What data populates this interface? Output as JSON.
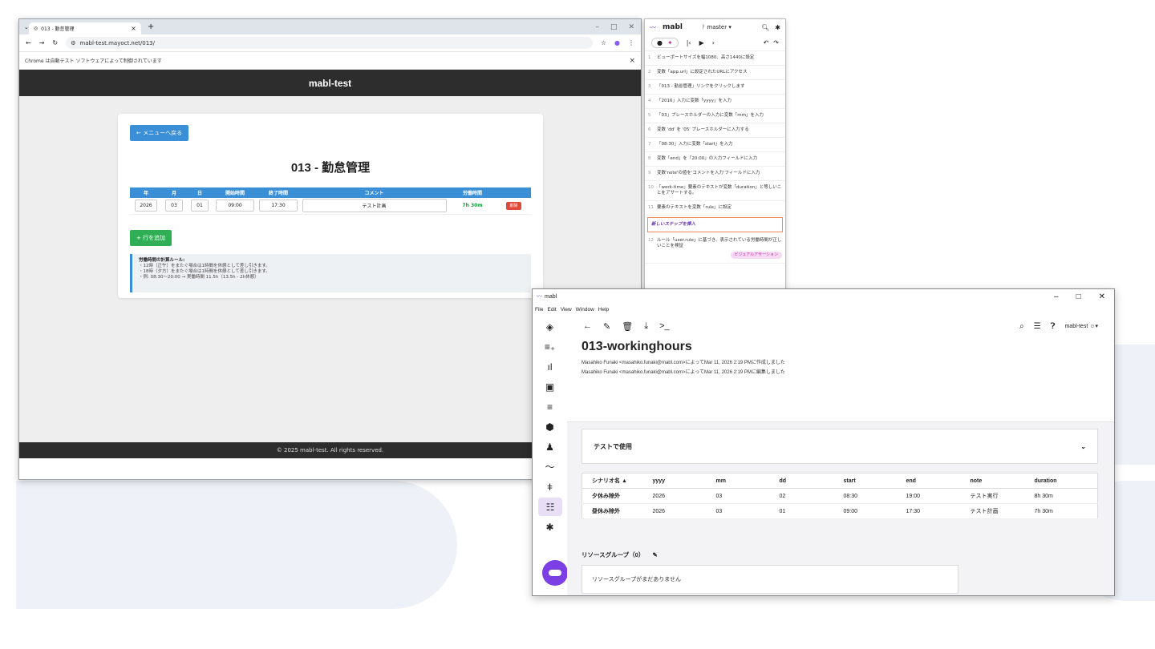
{
  "chrome": {
    "tab_title": "013 - 勤怠管理",
    "url": "mabl-test.mayoct.net/013/",
    "info_bar": "Chrome は自動テスト ソフトウェアによって制御されています"
  },
  "site": {
    "header": "mabl-test",
    "back_button": "← メニューへ戻る",
    "title": "013 - 勤怠管理",
    "table_headers": [
      "年",
      "月",
      "日",
      "開始時間",
      "終了時間",
      "コメント",
      "労働時間",
      ""
    ],
    "row": {
      "year": "2026",
      "month": "03",
      "day": "01",
      "start": "09:00",
      "end": "17:30",
      "comment": "テスト計画",
      "duration": "7h 30m",
      "delete": "削除"
    },
    "add_row": "+ 行を追加",
    "rules_title": "労働時間の計算ルール:",
    "rules": [
      "・12時（正午）をまたぐ場合は1時間を休憩として差し引きます。",
      "・18時（夕方）をまたぐ場合は1時間を休憩として差し引きます。",
      "・例: 08:30〜20:00 → 実働時間 11.5h（13.5h - 2h休憩）"
    ],
    "footer": "© 2025 mabl-test. All rights reserved."
  },
  "trainer": {
    "logo": "mabl",
    "branch": "master",
    "steps": [
      {
        "n": "1",
        "text": "ビューポートサイズを幅1080、高さ1440に設定"
      },
      {
        "n": "2",
        "text": "変数「app.url」に設定されたURLにアクセス"
      },
      {
        "n": "3",
        "text": "「013 - 勤怠管理」リンクをクリックします"
      },
      {
        "n": "4",
        "text": "「2016」入力に変数「yyyy」を入力"
      },
      {
        "n": "5",
        "text": "「03」プレースホルダーの入力に変数「mm」を入力"
      },
      {
        "n": "6",
        "text": "変数 'dd' を '05' プレースホルダーに入力する"
      },
      {
        "n": "7",
        "text": "「08:30」入力に変数「start」を入力"
      },
      {
        "n": "8",
        "text": "変数「end」を「20:00」の入力フィールドに入力"
      },
      {
        "n": "9",
        "text": "変数'note'の値を'コメントを入力'フィールドに入力"
      },
      {
        "n": "10",
        "text": "「work-time」要素のテキストが変数「duration」と等しいことをアサートする。"
      },
      {
        "n": "11",
        "text": "要素のテキストを変数「rule」に設定"
      }
    ],
    "insert_step": "新しいステップを挿入",
    "step12": {
      "n": "12",
      "text": "ルール「user.rule」に基づき、表示されている労働時間が正しいことを検証"
    },
    "visual_tag": "ビジュアルアサーション"
  },
  "app": {
    "window_title": "mabl",
    "menu": [
      "File",
      "Edit",
      "View",
      "Window",
      "Help"
    ],
    "user": "mabl-test",
    "title": "013-workinghours",
    "created": "Masahiko Funaki <masahiko.funaki@mabl.com>によってMar 11, 2026 2:19 PMに作成しました",
    "edited": "Masahiko Funaki <masahiko.funaki@mabl.com>によってMar 11, 2026 2:19 PMに編集しました",
    "used_in_tests": "テストで使用",
    "table_headers": [
      "シナリオ名 ▲",
      "yyyy",
      "mm",
      "dd",
      "start",
      "end",
      "note",
      "duration"
    ],
    "rows": [
      [
        "夕休み除外",
        "2026",
        "03",
        "02",
        "08:30",
        "19:00",
        "テスト実行",
        "8h 30m"
      ],
      [
        "昼休み除外",
        "2026",
        "03",
        "01",
        "09:00",
        "17:30",
        "テスト計画",
        "7h 30m"
      ]
    ],
    "resource_group_title": "リソースグループ（0）",
    "resource_group_empty": "リソースグループがまだありません"
  }
}
